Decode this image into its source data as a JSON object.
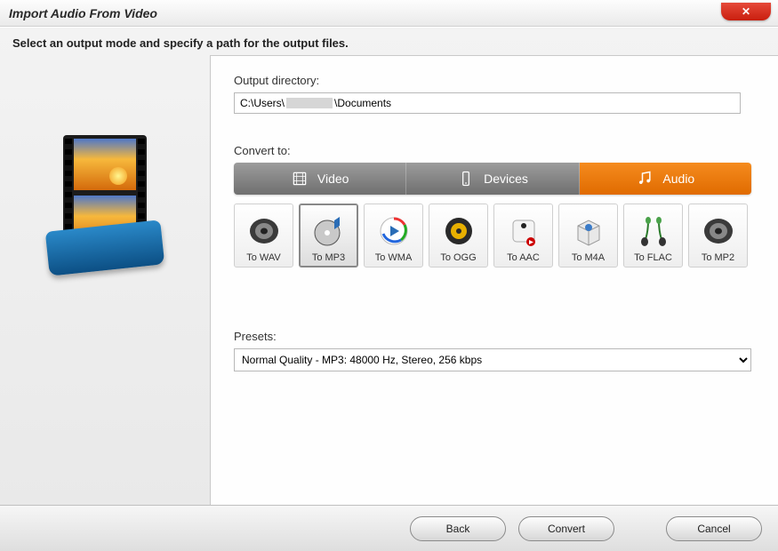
{
  "window": {
    "title": "Import Audio From Video"
  },
  "instruction": "Select an output mode and specify a path for the output files.",
  "output": {
    "label": "Output directory:",
    "path_prefix": "C:\\Users\\",
    "path_suffix": "\\Documents"
  },
  "convert": {
    "label": "Convert to:",
    "tabs": [
      {
        "label": "Video",
        "active": false
      },
      {
        "label": "Devices",
        "active": false
      },
      {
        "label": "Audio",
        "active": true
      }
    ],
    "formats": [
      {
        "label": "To WAV",
        "selected": false,
        "icon": "speaker"
      },
      {
        "label": "To MP3",
        "selected": true,
        "icon": "disc"
      },
      {
        "label": "To WMA",
        "selected": false,
        "icon": "play-circle"
      },
      {
        "label": "To OGG",
        "selected": false,
        "icon": "ogg-cone"
      },
      {
        "label": "To AAC",
        "selected": false,
        "icon": "aac-box"
      },
      {
        "label": "To M4A",
        "selected": false,
        "icon": "m4a-box"
      },
      {
        "label": "To FLAC",
        "selected": false,
        "icon": "flac-buds"
      },
      {
        "label": "To MP2",
        "selected": false,
        "icon": "speaker"
      }
    ]
  },
  "presets": {
    "label": "Presets:",
    "selected": "Normal Quality - MP3: 48000 Hz, Stereo, 256 kbps"
  },
  "buttons": {
    "back": "Back",
    "convert": "Convert",
    "cancel": "Cancel"
  }
}
